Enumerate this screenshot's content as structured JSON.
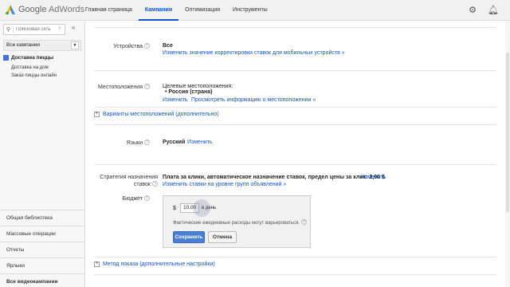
{
  "app": {
    "logo_google": "Google",
    "logo_product": "AdWords"
  },
  "nav": {
    "tabs": [
      "Главная страница",
      "Кампании",
      "Оптимизация",
      "Инструменты"
    ]
  },
  "sidebar": {
    "search_placeholder": "Поисковая сеть",
    "all_campaigns": "Все кампании",
    "campaign": "Доставка пиццы",
    "ad_groups": [
      "Доставка на дом",
      "Заказ пиццы онлайн"
    ],
    "bottom_items": [
      "Общая библиотека",
      "Массовые операции",
      "Отчеты",
      "Ярлыки",
      "Все видеокампании"
    ]
  },
  "settings": {
    "devices": {
      "label": "Устройства",
      "value": "Все",
      "link": "Изменить значение корректировки ставок для мобильных устройств »"
    },
    "locations": {
      "label": "Местоположения",
      "target_label": "Целевые местоположения:",
      "target_value": "Россия (страна)",
      "edit_link": "Изменить",
      "view_link": "Просмотреть информацию о местоположении »"
    },
    "location_options": "Варианты местоположений (дополнительно)",
    "languages": {
      "label": "Языки",
      "value": "Русский",
      "edit_link": "Изменить"
    },
    "bid_strategy": {
      "label_line1": "Стратегия назначения",
      "label_line2": "ставок",
      "value": "Плата за клики, автоматическое назначение ставок, предел цены за клик: 2,00 $",
      "edit_link": "Изменить",
      "adgroup_link": "Изменить ставки на уровне групп объявлений »"
    },
    "budget": {
      "label": "Бюджет",
      "currency": "$",
      "amount": "10,00",
      "per_day": "в день",
      "note": "Фактические ежедневные расходы могут варьироваться.",
      "save": "Сохранить",
      "cancel": "Отмена"
    },
    "delivery_method": "Метод показа (дополнительные настройки)"
  },
  "colors": {
    "accent": "#1155cc",
    "save_button": "#4a7fd6"
  }
}
